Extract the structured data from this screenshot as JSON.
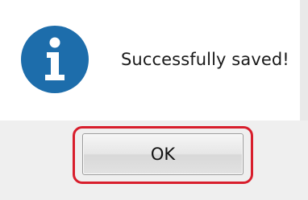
{
  "dialog": {
    "icon": "info-icon",
    "message": "Successfully saved!",
    "ok_label": "OK"
  },
  "colors": {
    "icon_blue": "#1d6dab",
    "highlight_red": "#d81e2c"
  }
}
